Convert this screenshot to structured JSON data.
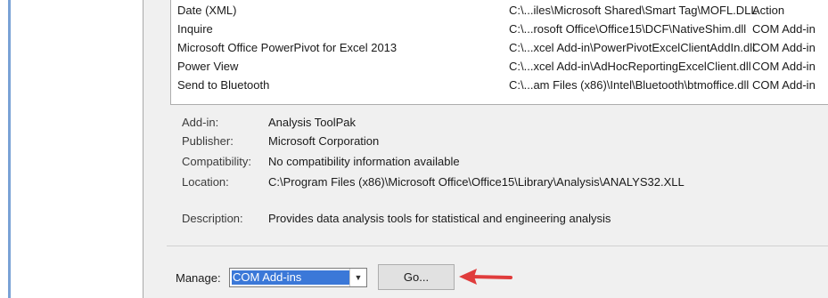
{
  "addins_list": [
    {
      "name": "Date (XML)",
      "location": "C:\\...iles\\Microsoft Shared\\Smart Tag\\MOFL.DLL",
      "type": "Action"
    },
    {
      "name": "Inquire",
      "location": "C:\\...rosoft Office\\Office15\\DCF\\NativeShim.dll",
      "type": "COM Add-in"
    },
    {
      "name": "Microsoft Office PowerPivot for Excel 2013",
      "location": "C:\\...xcel Add-in\\PowerPivotExcelClientAddIn.dll",
      "type": "COM Add-in"
    },
    {
      "name": "Power View",
      "location": "C:\\...xcel Add-in\\AdHocReportingExcelClient.dll",
      "type": "COM Add-in"
    },
    {
      "name": "Send to Bluetooth",
      "location": "C:\\...am Files (x86)\\Intel\\Bluetooth\\btmoffice.dll",
      "type": "COM Add-in"
    }
  ],
  "details": {
    "addin_label": "Add-in:",
    "addin_value": "Analysis ToolPak",
    "publisher_label": "Publisher:",
    "publisher_value": "Microsoft Corporation",
    "compat_label": "Compatibility:",
    "compat_value": "No compatibility information available",
    "location_label": "Location:",
    "location_value": "C:\\Program Files (x86)\\Microsoft Office\\Office15\\Library\\Analysis\\ANALYS32.XLL",
    "description_label": "Description:",
    "description_value": "Provides data analysis tools for statistical and engineering analysis"
  },
  "manage": {
    "label": "Manage:",
    "selected": "COM Add-ins",
    "go_label": "Go..."
  },
  "colors": {
    "selection": "#3b78d8",
    "arrow": "#e03c3c",
    "dialog_bg": "#f0f0f0"
  }
}
